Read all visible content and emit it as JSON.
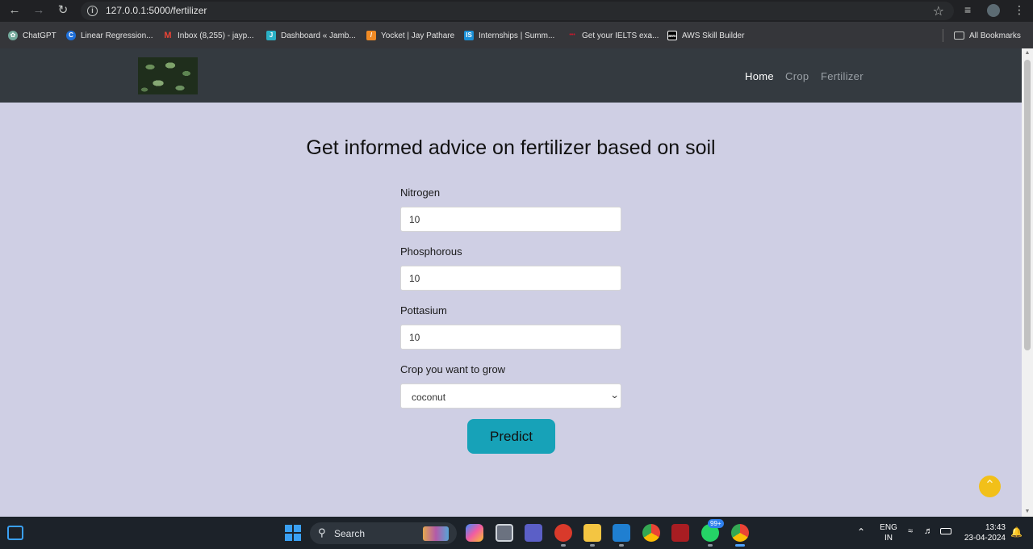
{
  "browser": {
    "url": "127.0.0.1:5000/fertilizer",
    "bookmarks": [
      {
        "label": "ChatGPT",
        "icon": "chatgpt-icon",
        "color": "#74aa9c"
      },
      {
        "label": "Linear Regression...",
        "icon": "c-icon",
        "color": "#1e6fd9"
      },
      {
        "label": "Inbox (8,255) - jayp...",
        "icon": "gmail-icon",
        "color": "#ea4335"
      },
      {
        "label": "Dashboard « Jamb...",
        "icon": "j-icon",
        "color": "#2ab0c5"
      },
      {
        "label": "Yocket | Jay Pathare",
        "icon": "yocket-icon",
        "color": "#f08a24"
      },
      {
        "label": "Internships | Summ...",
        "icon": "is-icon",
        "color": "#1a8fd6"
      },
      {
        "label": "Get your IELTS exa...",
        "icon": "ielts-icon",
        "color": "#d0182c"
      },
      {
        "label": "AWS Skill Builder",
        "icon": "aws-icon",
        "color": "#000000"
      }
    ],
    "all_bookmarks_label": "All Bookmarks"
  },
  "navbar": {
    "links": {
      "home": "Home",
      "crop": "Crop",
      "fertilizer": "Fertilizer"
    },
    "active_color": "#ffffff",
    "inactive_color": "#9aa0a6"
  },
  "main": {
    "heading": "Get informed advice on fertilizer based on soil",
    "fields": {
      "nitrogen": {
        "label": "Nitrogen",
        "value": "10"
      },
      "phosphorous": {
        "label": "Phosphorous",
        "value": "10"
      },
      "pottasium": {
        "label": "Pottasium",
        "value": "10"
      }
    },
    "crop_select": {
      "label": "Crop you want to grow",
      "value": "coconut"
    },
    "predict_label": "Predict",
    "accent_color": "#17a2b8"
  },
  "taskbar": {
    "search_label": "Search",
    "language": "ENG",
    "region": "IN",
    "time": "13:43",
    "date": "23-04-2024",
    "whatsapp_badge": "99+"
  }
}
